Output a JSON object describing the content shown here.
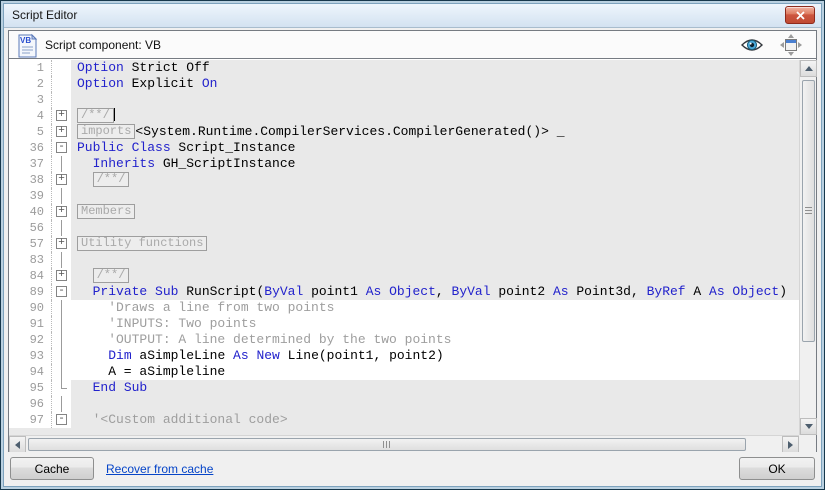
{
  "window": {
    "title": "Script Editor"
  },
  "titlebar": {
    "close_icon": "close-icon"
  },
  "header": {
    "component_icon": "vb-document-icon",
    "label": "Script component: VB",
    "preview_icon": "eye-icon",
    "fit_icon": "fit-window-icon"
  },
  "colors": {
    "keyword": "#2222cc",
    "comment": "#9e9e9e",
    "folded": "#a9a9a9",
    "link": "#0645c8",
    "close_button": "#ce5741",
    "readonly_bg": "#e9e9e9",
    "editable_bg": "#ffffff"
  },
  "editor": {
    "rows": [
      {
        "n": "1",
        "fold": "",
        "seg": [
          [
            "k",
            "Option"
          ],
          [
            "p",
            " Strict Off"
          ]
        ]
      },
      {
        "n": "2",
        "fold": "",
        "seg": [
          [
            "k",
            "Option"
          ],
          [
            "p",
            " Explicit "
          ],
          [
            "k",
            "On"
          ]
        ]
      },
      {
        "n": "3",
        "fold": "",
        "seg": []
      },
      {
        "n": "4",
        "fold": "+",
        "seg": [
          [
            "box",
            "/**/"
          ],
          [
            "caret",
            ""
          ]
        ]
      },
      {
        "n": "5",
        "fold": "+",
        "seg": [
          [
            "box",
            "imports"
          ],
          [
            "p",
            "<System.Runtime.CompilerServices.CompilerGenerated()> _"
          ]
        ]
      },
      {
        "n": "36",
        "fold": "-",
        "seg": [
          [
            "k",
            "Public Class"
          ],
          [
            "p",
            " Script_Instance"
          ]
        ]
      },
      {
        "n": "37",
        "fold": "|",
        "seg": [
          [
            "p",
            "  "
          ],
          [
            "k",
            "Inherits"
          ],
          [
            "p",
            " GH_ScriptInstance"
          ]
        ]
      },
      {
        "n": "38",
        "fold": "+",
        "seg": [
          [
            "p",
            "  "
          ],
          [
            "box",
            "/**/"
          ]
        ]
      },
      {
        "n": "39",
        "fold": "|",
        "seg": []
      },
      {
        "n": "40",
        "fold": "+",
        "seg": [
          [
            "box",
            "Members"
          ]
        ]
      },
      {
        "n": "56",
        "fold": "|",
        "seg": []
      },
      {
        "n": "57",
        "fold": "+",
        "seg": [
          [
            "box",
            "Utility functions"
          ]
        ]
      },
      {
        "n": "83",
        "fold": "|",
        "seg": []
      },
      {
        "n": "84",
        "fold": "+",
        "seg": [
          [
            "p",
            "  "
          ],
          [
            "box",
            "/**/"
          ]
        ]
      },
      {
        "n": "89",
        "fold": "-",
        "seg": [
          [
            "p",
            "  "
          ],
          [
            "k",
            "Private Sub"
          ],
          [
            "p",
            " RunScript("
          ],
          [
            "k",
            "ByVal"
          ],
          [
            "p",
            " point1 "
          ],
          [
            "k",
            "As Object"
          ],
          [
            "p",
            ", "
          ],
          [
            "k",
            "ByVal"
          ],
          [
            "p",
            " point2 "
          ],
          [
            "k",
            "As"
          ],
          [
            "p",
            " Point3d, "
          ],
          [
            "k",
            "ByRef"
          ],
          [
            "p",
            " A "
          ],
          [
            "k",
            "As Object"
          ],
          [
            "p",
            ")"
          ]
        ]
      },
      {
        "n": "90",
        "bg": "edit",
        "fold": "|",
        "seg": [
          [
            "c",
            "    'Draws a line from two points"
          ]
        ]
      },
      {
        "n": "91",
        "bg": "edit",
        "fold": "|",
        "seg": [
          [
            "c",
            "    'INPUTS: Two points"
          ]
        ]
      },
      {
        "n": "92",
        "bg": "edit",
        "fold": "|",
        "seg": [
          [
            "c",
            "    'OUTPUT: A line determined by the two points"
          ]
        ]
      },
      {
        "n": "93",
        "bg": "edit",
        "fold": "|",
        "seg": [
          [
            "p",
            "    "
          ],
          [
            "k",
            "Dim"
          ],
          [
            "p",
            " aSimpleLine "
          ],
          [
            "k",
            "As New"
          ],
          [
            "p",
            " Line(point1, point2)"
          ]
        ]
      },
      {
        "n": "94",
        "bg": "edit",
        "fold": "|",
        "seg": [
          [
            "p",
            "    A = aSimpleline"
          ]
        ]
      },
      {
        "n": "95",
        "fold": "L",
        "seg": [
          [
            "p",
            "  "
          ],
          [
            "k",
            "End Sub"
          ]
        ]
      },
      {
        "n": "96",
        "fold": "|",
        "seg": []
      },
      {
        "n": "97",
        "fold": "-",
        "seg": [
          [
            "p",
            "  "
          ],
          [
            "c",
            "'<Custom additional code>"
          ]
        ]
      }
    ]
  },
  "scrollbars": {
    "vertical_up_icon": "scroll-up-arrow-icon",
    "vertical_down_icon": "scroll-down-arrow-icon",
    "horizontal_left_icon": "scroll-left-arrow-icon",
    "horizontal_right_icon": "scroll-right-arrow-icon"
  },
  "footer": {
    "cache_button": "Cache",
    "recover_link": "Recover from cache",
    "ok_button": "OK"
  }
}
